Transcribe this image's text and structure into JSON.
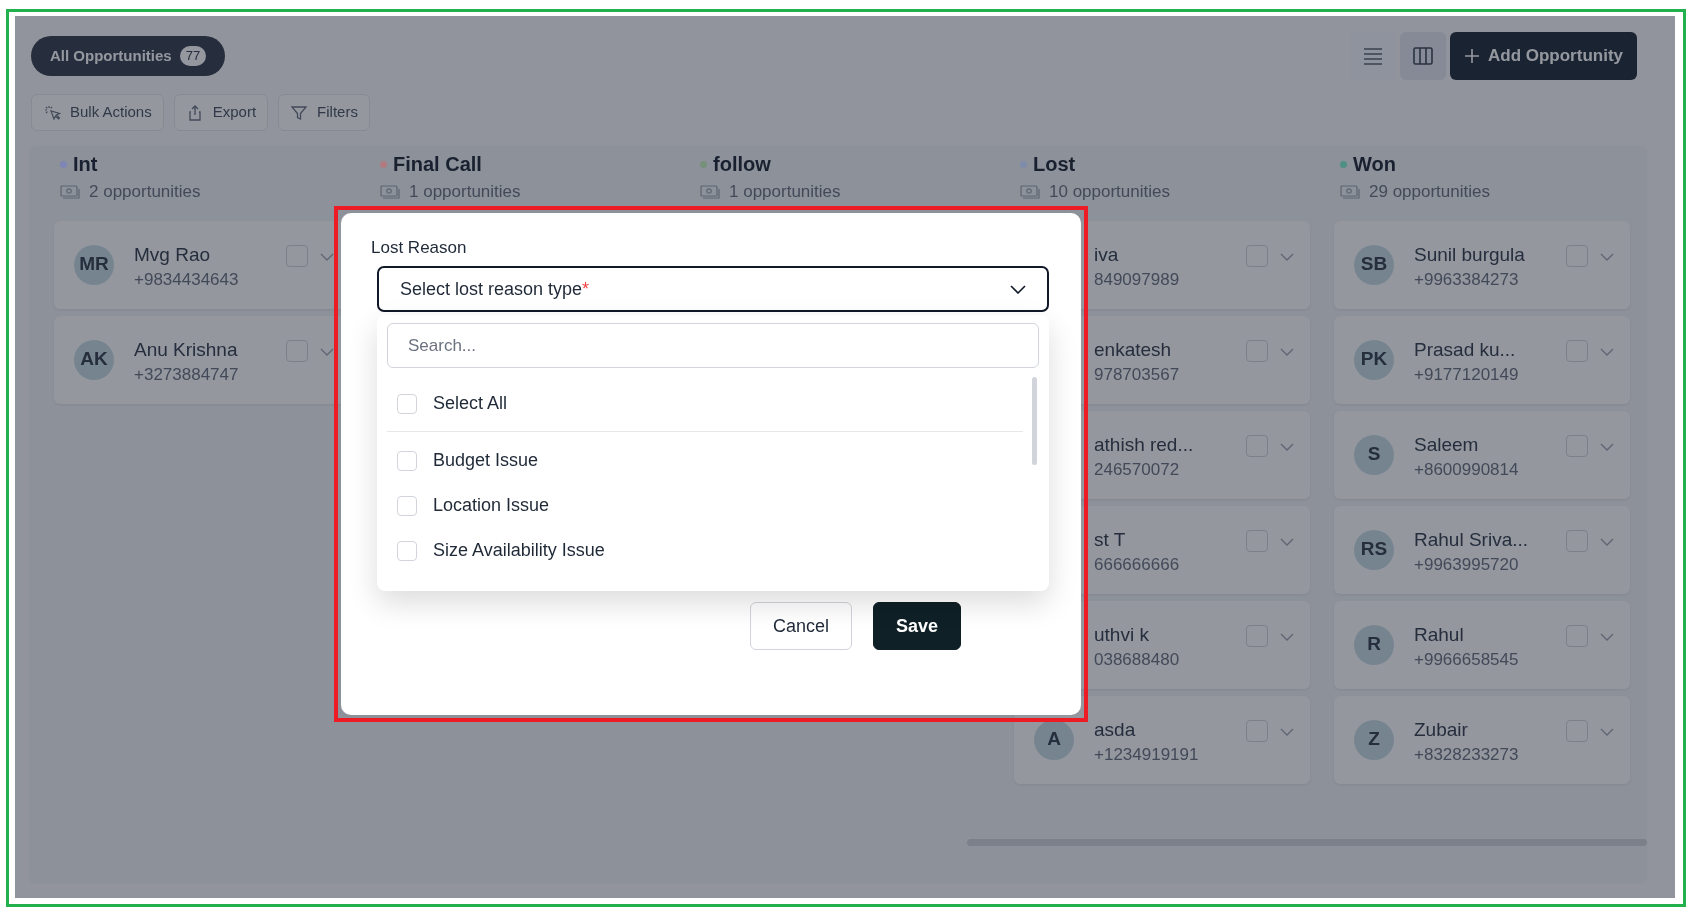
{
  "filter_pill": {
    "label": "All Opportunities",
    "count": "77"
  },
  "toolbar": [
    {
      "kind": "bulk",
      "label": "Bulk Actions"
    },
    {
      "kind": "export",
      "label": "Export"
    },
    {
      "kind": "filter",
      "label": "Filters"
    }
  ],
  "view_toggle": [
    {
      "kind": "list",
      "selected": false
    },
    {
      "kind": "board",
      "selected": true
    }
  ],
  "add_button": {
    "label": "Add Opportunity"
  },
  "columns": [
    {
      "name": "Int",
      "color": "#7d86b5",
      "count": "2 opportunities",
      "cards": [
        {
          "initials": "MR",
          "name": "Mvg Rao",
          "phone": "+9834434643",
          "checked": false
        },
        {
          "initials": "AK",
          "name": "Anu Krishna",
          "phone": "+3273884747",
          "checked": false
        }
      ]
    },
    {
      "name": "Final Call",
      "color": "#b07b80",
      "count": "1 opportunities"
    },
    {
      "name": "follow",
      "color": "#77907a",
      "count": "1 opportunities"
    },
    {
      "name": "Lost",
      "color": "#7f8bab",
      "count": "10 opportunities",
      "cards": [
        {
          "name": "iva",
          "phone": "849097989",
          "checked": false
        },
        {
          "name": "enkatesh",
          "phone": "978703567",
          "checked": false
        },
        {
          "name": "athish red...",
          "phone": "246570072",
          "checked": false
        },
        {
          "name": "st T",
          "phone": "666666666",
          "checked": false
        },
        {
          "name": "uthvi k",
          "phone": "038688480",
          "checked": false
        },
        {
          "initials": "A",
          "name": "asda",
          "phone": "+1234919191",
          "checked": false
        }
      ]
    },
    {
      "name": "Won",
      "color": "#4f8f86",
      "count": "29 opportunities",
      "cards": [
        {
          "initials": "SB",
          "name": "Sunil burgula",
          "phone": "+9963384273",
          "checked": false
        },
        {
          "initials": "PK",
          "name": "Prasad ku...",
          "phone": "+9177120149",
          "checked": false
        },
        {
          "initials": "S",
          "name": "Saleem",
          "phone": "+8600990814",
          "checked": false
        },
        {
          "initials": "RS",
          "name": "Rahul Sriva...",
          "phone": "+9963995720",
          "checked": false
        },
        {
          "initials": "R",
          "name": "Rahul",
          "phone": "+9966658545",
          "checked": false
        },
        {
          "initials": "Z",
          "name": "Zubair",
          "phone": "+8328233273",
          "checked": false
        }
      ]
    }
  ],
  "dialog": {
    "label": "Lost Reason",
    "select": {
      "placeholder": "Select lost reason type",
      "required_mark": "*",
      "expanded": true
    },
    "search": {
      "placeholder": "Search..."
    },
    "select_all": {
      "label": "Select All",
      "checked": false
    },
    "options": [
      {
        "label": "Budget Issue",
        "checked": false
      },
      {
        "label": "Location Issue",
        "checked": false
      },
      {
        "label": "Size Availability Issue",
        "checked": false
      }
    ],
    "buttons": [
      {
        "kind": "secondary",
        "label": "Cancel"
      },
      {
        "kind": "primary",
        "label": "Save"
      }
    ]
  }
}
